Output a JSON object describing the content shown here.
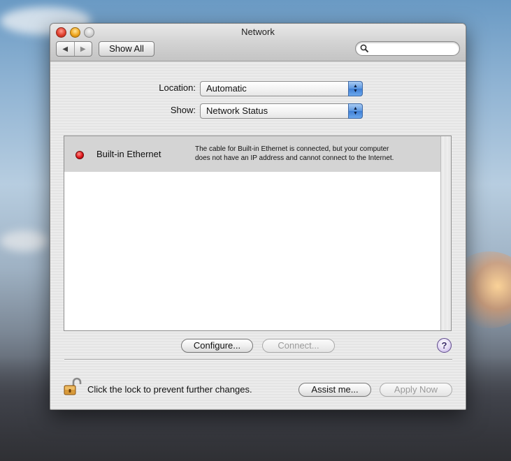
{
  "window": {
    "title": "Network",
    "toolbar": {
      "back_icon": "back-arrow-icon",
      "forward_icon": "forward-arrow-icon",
      "show_all_label": "Show All",
      "search_value": "",
      "search_icon": "magnifier-icon"
    }
  },
  "location": {
    "label": "Location:",
    "value": "Automatic"
  },
  "show": {
    "label": "Show:",
    "value": "Network Status"
  },
  "status_list": [
    {
      "name": "Built-in Ethernet",
      "status_color": "#e0151b",
      "description_line1": "The cable for Built-in Ethernet is connected, but your computer",
      "description_line2": "does not have an IP address and cannot connect to the Internet."
    }
  ],
  "buttons": {
    "configure": "Configure...",
    "connect": "Connect...",
    "help": "?",
    "assist": "Assist me...",
    "apply": "Apply Now"
  },
  "footer": {
    "lock_text": "Click the lock to prevent further changes.",
    "lock_icon": "open-lock-icon"
  }
}
